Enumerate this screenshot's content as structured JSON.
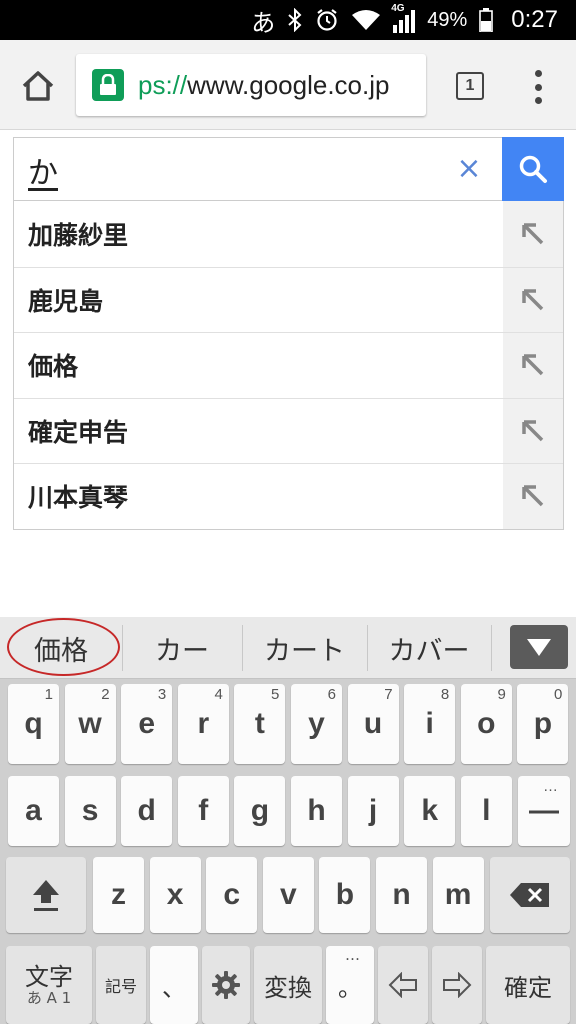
{
  "status": {
    "ime": "あ",
    "network": "4G",
    "battery": "49%",
    "time": "0:27"
  },
  "browser": {
    "url_scheme_fragment": "ps://",
    "url_host": "www.google.co.jp",
    "tab_count": "1"
  },
  "search": {
    "query": "か",
    "clear_symbol": "×"
  },
  "suggestions": [
    {
      "text": "加藤紗里"
    },
    {
      "text": "鹿児島"
    },
    {
      "text": "価格"
    },
    {
      "text": "確定申告"
    },
    {
      "text": "川本真琴"
    }
  ],
  "keyboard": {
    "candidates": [
      "価格",
      "カー",
      "カート",
      "カバー"
    ],
    "row1": [
      {
        "k": "q",
        "h": "1"
      },
      {
        "k": "w",
        "h": "2"
      },
      {
        "k": "e",
        "h": "3"
      },
      {
        "k": "r",
        "h": "4"
      },
      {
        "k": "t",
        "h": "5"
      },
      {
        "k": "y",
        "h": "6"
      },
      {
        "k": "u",
        "h": "7"
      },
      {
        "k": "i",
        "h": "8"
      },
      {
        "k": "o",
        "h": "9"
      },
      {
        "k": "p",
        "h": "0"
      }
    ],
    "row2": [
      "a",
      "s",
      "d",
      "f",
      "g",
      "h",
      "j",
      "k",
      "l"
    ],
    "row2_last": "—",
    "row2_last_hint": "…",
    "row3": [
      "z",
      "x",
      "c",
      "v",
      "b",
      "n",
      "m"
    ],
    "mode_label": "文字",
    "mode_sub": "あ A 1",
    "symbol_label": "記号",
    "comma_label": "、",
    "convert_label": "変換",
    "period_label": "。",
    "period_hint": "…",
    "enter_label": "確定"
  }
}
